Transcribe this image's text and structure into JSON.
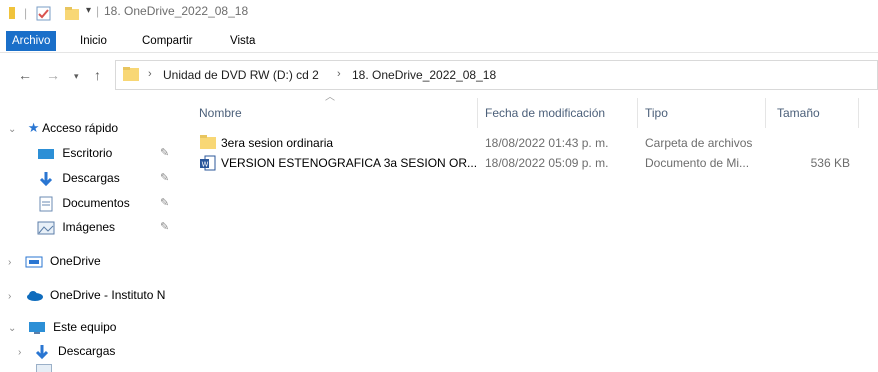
{
  "window": {
    "title": "18. OneDrive_2022_08_18"
  },
  "ribbon": {
    "tabs": [
      "Archivo",
      "Inicio",
      "Compartir",
      "Vista"
    ]
  },
  "address": {
    "path": [
      "Unidad de DVD RW (D:) cd 2",
      "18. OneDrive_2022_08_18"
    ]
  },
  "nav": {
    "quick_access": "Acceso rápido",
    "quick_items": [
      {
        "label": "Escritorio",
        "icon": "desktop-icon"
      },
      {
        "label": "Descargas",
        "icon": "download-icon"
      },
      {
        "label": "Documentos",
        "icon": "documents-icon"
      },
      {
        "label": "Imágenes",
        "icon": "pictures-icon"
      }
    ],
    "onedrive": "OneDrive",
    "onedrive_org": "OneDrive - Instituto N",
    "this_pc": "Este equipo",
    "pc_items": [
      {
        "label": "Descargas",
        "icon": "download-icon"
      }
    ]
  },
  "columns": {
    "name": "Nombre",
    "date": "Fecha de modificación",
    "type": "Tipo",
    "size": "Tamaño"
  },
  "files": [
    {
      "name": "3era sesion ordinaria",
      "date": "18/08/2022 01:43 p. m.",
      "type": "Carpeta de archivos",
      "size": "",
      "icon": "folder-icon"
    },
    {
      "name": "VERSION ESTENOGRAFICA 3a SESION OR...",
      "date": "18/08/2022 05:09 p. m.",
      "type": "Documento de Mi...",
      "size": "536 KB",
      "icon": "word-document-icon"
    }
  ],
  "colors": {
    "accent": "#1a6fc9",
    "folder": "#f8d775",
    "header_text": "#4c607a"
  }
}
